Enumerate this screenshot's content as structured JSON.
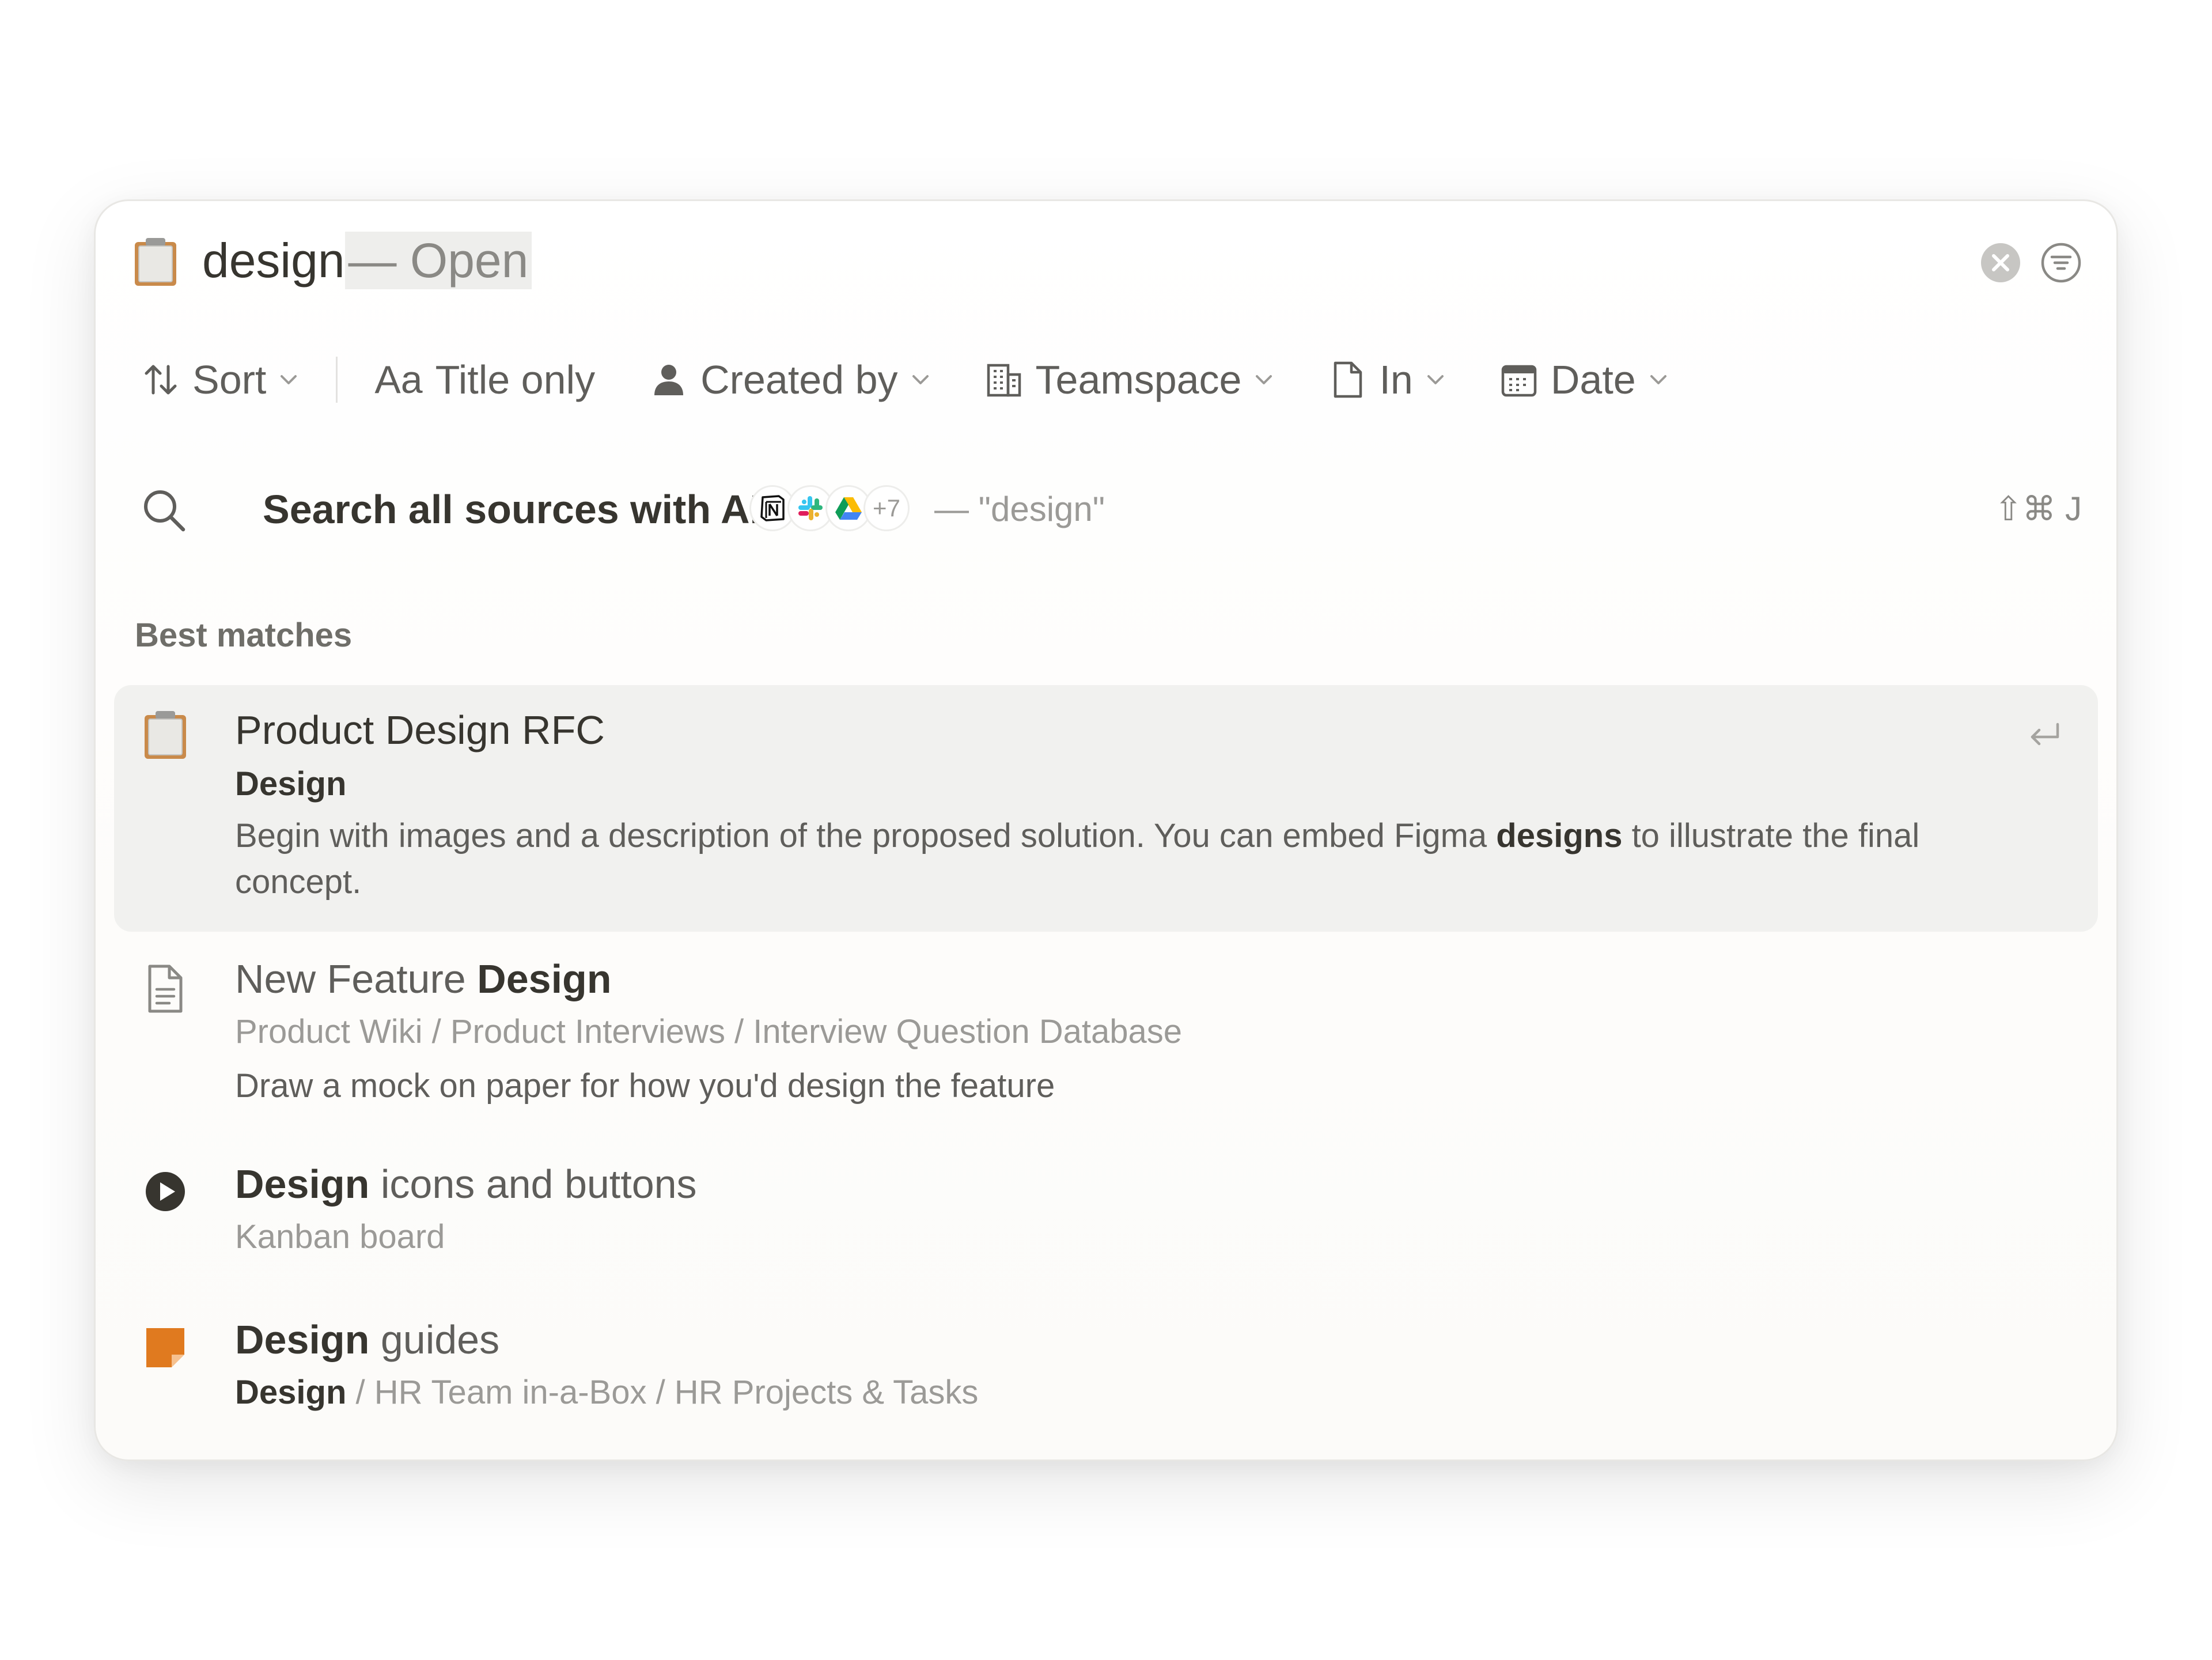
{
  "search": {
    "query": "design",
    "query_suffix": "— Open"
  },
  "filters": [
    {
      "label": "Sort",
      "icon": "sort-arrows-icon",
      "dropdown": true
    },
    {
      "label": "Title only",
      "icon": "aa-icon",
      "dropdown": false,
      "glyph": "Aa"
    },
    {
      "label": "Created by",
      "icon": "person-icon",
      "dropdown": true
    },
    {
      "label": "Teamspace",
      "icon": "building-icon",
      "dropdown": true
    },
    {
      "label": "In",
      "icon": "document-icon",
      "dropdown": true
    },
    {
      "label": "Date",
      "icon": "calendar-icon",
      "dropdown": true
    }
  ],
  "ai_search": {
    "label": "Search all sources with AI",
    "sources": [
      "notion-icon",
      "slack-icon",
      "google-drive-icon"
    ],
    "more_sources": "+7",
    "query_echo": "— \"design\"",
    "shortcut": "⇧⌘ J"
  },
  "section": {
    "title": "Best matches"
  },
  "results": [
    {
      "icon": "clipboard-icon",
      "title_parts": [
        "Product Design RFC"
      ],
      "path_bold": "Design",
      "desc_before": "Begin with images and a description of the proposed solution. You can embed Figma ",
      "desc_bold": "designs",
      "desc_after": " to illustrate the final concept."
    },
    {
      "icon": "page-icon",
      "title_muted": "New Feature ",
      "title_bold": "Design",
      "path": "Product Wiki / Product Interviews / Interview Question Database",
      "desc": "Draw a mock on paper for how you'd design the feature"
    },
    {
      "icon": "play-circle-icon",
      "title_bold": "Design",
      "title_muted": " icons and buttons",
      "path": "Kanban board"
    },
    {
      "icon": "orange-note-icon",
      "title_bold": "Design",
      "title_muted": " guides",
      "path_bold": "Design",
      "path_rest": " / HR Team in-a-Box / HR Projects & Tasks"
    }
  ],
  "colors": {
    "text": "#37352f",
    "muted": "#9b9a97",
    "selected_bg": "#f1f1ef",
    "orange": "#e07a1f"
  }
}
